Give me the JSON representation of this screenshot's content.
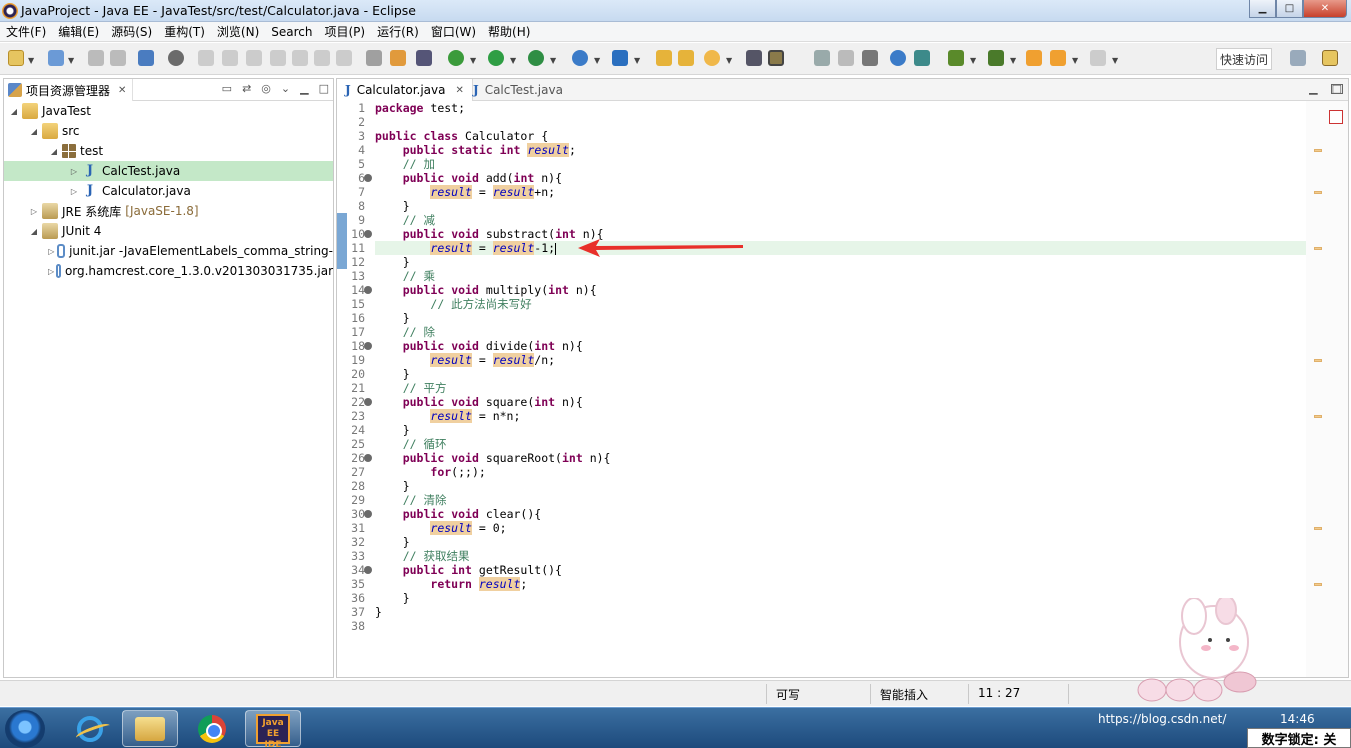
{
  "window": {
    "title": "JavaProject - Java EE - JavaTest/src/test/Calculator.java - Eclipse",
    "minimize_glyph": "▁",
    "maximize_glyph": "□",
    "close_glyph": "✕"
  },
  "menu": [
    "文件(F)",
    "编辑(E)",
    "源码(S)",
    "重构(T)",
    "浏览(N)",
    "Search",
    "项目(P)",
    "运行(R)",
    "窗口(W)",
    "帮助(H)"
  ],
  "toolbar": {
    "quick_access_label": "快速访问"
  },
  "package_explorer": {
    "tab_label": "项目资源管理器",
    "tree": [
      {
        "label": "JavaTest",
        "icon": "project-icon",
        "indent": 0,
        "expanded": true
      },
      {
        "label": "src",
        "icon": "folder-icon",
        "indent": 1,
        "expanded": true
      },
      {
        "label": "test",
        "icon": "package-icon",
        "indent": 2,
        "expanded": true
      },
      {
        "label": "CalcTest.java",
        "icon": "java-file-icon",
        "indent": 3,
        "expanded": false,
        "selected": true
      },
      {
        "label": "Calculator.java",
        "icon": "java-file-icon",
        "indent": 3,
        "expanded": false
      },
      {
        "label": "JRE 系统库",
        "secondary": "[JavaSE-1.8]",
        "icon": "library-icon",
        "indent": 1,
        "expanded": false
      },
      {
        "label": "JUnit 4",
        "icon": "library-icon",
        "indent": 1,
        "expanded": true
      },
      {
        "label": "junit.jar -JavaElementLabels_comma_string-",
        "icon": "jar-icon",
        "indent": 2,
        "expanded": false
      },
      {
        "label": "org.hamcrest.core_1.3.0.v201303031735.jar",
        "icon": "jar-icon",
        "indent": 2,
        "expanded": false
      }
    ]
  },
  "editor": {
    "tabs": [
      {
        "label": "Calculator.java",
        "active": true
      },
      {
        "label": "CalcTest.java",
        "active": false
      }
    ],
    "current_line": 11,
    "lines": [
      {
        "n": 1,
        "text": "package test;"
      },
      {
        "n": 2,
        "text": ""
      },
      {
        "n": 3,
        "text": "public class Calculator {"
      },
      {
        "n": 4,
        "text": "    public static int result;"
      },
      {
        "n": 5,
        "text": "    // 加"
      },
      {
        "n": 6,
        "text": "    public void add(int n){",
        "fold": true
      },
      {
        "n": 7,
        "text": "        result = result+n;"
      },
      {
        "n": 8,
        "text": "    }"
      },
      {
        "n": 9,
        "text": "    // 减"
      },
      {
        "n": 10,
        "text": "    public void substract(int n){",
        "fold": true
      },
      {
        "n": 11,
        "text": "        result = result-1;"
      },
      {
        "n": 12,
        "text": "    }"
      },
      {
        "n": 13,
        "text": "    // 乘"
      },
      {
        "n": 14,
        "text": "    public void multiply(int n){",
        "fold": true
      },
      {
        "n": 15,
        "text": "        // 此方法尚未写好"
      },
      {
        "n": 16,
        "text": "    }"
      },
      {
        "n": 17,
        "text": "    // 除"
      },
      {
        "n": 18,
        "text": "    public void divide(int n){",
        "fold": true
      },
      {
        "n": 19,
        "text": "        result = result/n;"
      },
      {
        "n": 20,
        "text": "    }"
      },
      {
        "n": 21,
        "text": "    // 平方"
      },
      {
        "n": 22,
        "text": "    public void square(int n){",
        "fold": true
      },
      {
        "n": 23,
        "text": "        result = n*n;"
      },
      {
        "n": 24,
        "text": "    }"
      },
      {
        "n": 25,
        "text": "    // 循环"
      },
      {
        "n": 26,
        "text": "    public void squareRoot(int n){",
        "fold": true
      },
      {
        "n": 27,
        "text": "        for(;;);"
      },
      {
        "n": 28,
        "text": "    }"
      },
      {
        "n": 29,
        "text": "    // 清除"
      },
      {
        "n": 30,
        "text": "    public void clear(){",
        "fold": true
      },
      {
        "n": 31,
        "text": "        result = 0;"
      },
      {
        "n": 32,
        "text": "    }"
      },
      {
        "n": 33,
        "text": "    // 获取结果"
      },
      {
        "n": 34,
        "text": "    public int getResult(){",
        "fold": true
      },
      {
        "n": 35,
        "text": "        return result;"
      },
      {
        "n": 36,
        "text": "    }"
      },
      {
        "n": 37,
        "text": "}"
      },
      {
        "n": 38,
        "text": ""
      }
    ]
  },
  "status": {
    "writable": "可写",
    "insert_mode": "智能插入",
    "position": "11 : 27"
  },
  "taskbar": {
    "apps": [
      "internet-explorer-icon",
      "file-explorer-icon",
      "chrome-icon",
      "eclipse-icon"
    ],
    "eclipse_label": "Java EE IDE",
    "clock": "14:46",
    "tray_text": "https://blog.csdn.net/",
    "numlock": "数字锁定: 关"
  },
  "colors": {
    "keyword": "#7f0055",
    "comment": "#3f7f5f",
    "static_field": "#0000c0",
    "highlight": "#f0d0a0",
    "selection_row": "#c4e8c8",
    "annotation_arrow": "#e8302a"
  }
}
